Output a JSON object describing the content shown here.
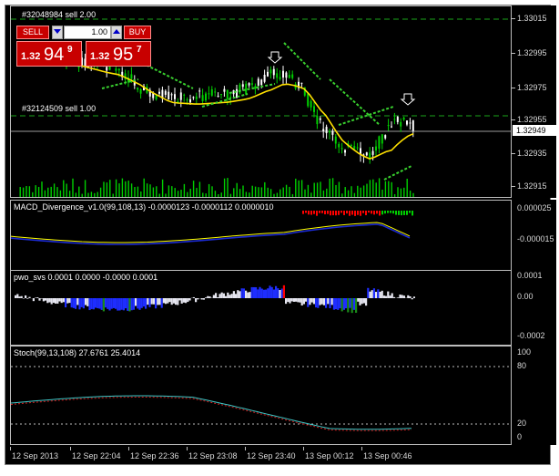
{
  "colors": {
    "background": "#000000",
    "bull_candle": "#00d000",
    "bear_candle": "#ffffff",
    "ma_yellow": "#ffe100",
    "parabolic": "#39d02f",
    "order_line": "#1aa31a",
    "macd_signal": "#ffff00",
    "macd_main": "#1b2ad0",
    "pwo_red": "#ff0000",
    "pwo_blue": "#1e2dff",
    "pwo_green": "#1a8a1a",
    "pwo_white": "#e6e6f0",
    "stoch_main": "#40c8c8",
    "stoch_signal": "#d02020"
  },
  "order_lines": [
    {
      "label": "#32048984 sell 2.00"
    },
    {
      "label": "#32124509 sell 1.00"
    }
  ],
  "trade_panel": {
    "sell_label": "SELL",
    "buy_label": "BUY",
    "lot": "1.00",
    "bid_small": "1.32",
    "bid_big": "94",
    "bid_sup": "9",
    "ask_small": "1.32",
    "ask_big": "95",
    "ask_sup": "7"
  },
  "price_axis": {
    "ticks": [
      "1.33015",
      "1.32995",
      "1.32975",
      "1.32955",
      "1.32935",
      "1.32915"
    ],
    "current": "1.32949"
  },
  "macd": {
    "label": "MACD_Divergence_v1.0(99,108,13) -0.0000123 -0.0000112 0.0000010",
    "axis_top": "0.000025",
    "axis_bottom": "-0.000015"
  },
  "pwo": {
    "label": "pwo_svs 0.0001 0.0000 -0.0000 0.0001",
    "axis_top": "0.0001",
    "axis_mid": "0.00",
    "axis_bottom": "-0.0002"
  },
  "stoch": {
    "label": "Stoch(99,13,108) 27.6761 25.4014",
    "axis_100": "100",
    "axis_80": "80",
    "axis_20": "20",
    "axis_0": "0"
  },
  "time_axis": [
    "12 Sep 2013",
    "12 Sep 22:04",
    "12 Sep 22:36",
    "12 Sep 23:08",
    "12 Sep 23:40",
    "13 Sep 00:12",
    "13 Sep 00:46"
  ]
}
